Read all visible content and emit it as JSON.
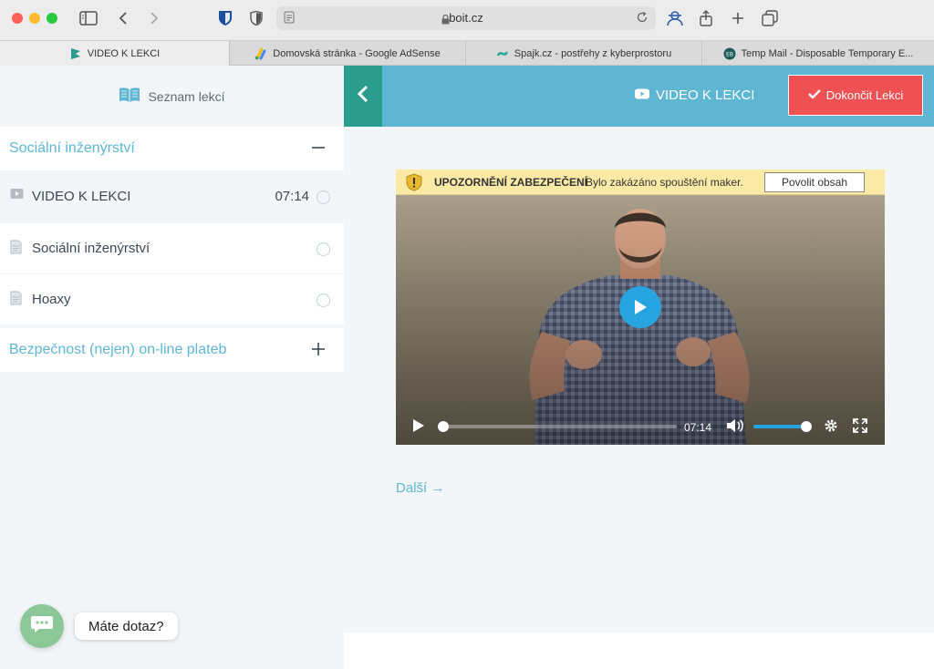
{
  "browser": {
    "url": "boit.cz",
    "tabs": [
      {
        "label": "VIDEO K LEKCI",
        "active": true
      },
      {
        "label": "Domovská stránka - Google AdSense",
        "active": false
      },
      {
        "label": "Spajk.cz - postřehy z kyberprostoru",
        "active": false
      },
      {
        "label": "Temp Mail - Disposable Temporary E...",
        "active": false
      }
    ]
  },
  "sidebar": {
    "header": "Seznam lekcí",
    "sections": [
      {
        "title": "Sociální inženýrství",
        "expanded": true,
        "lessons": [
          {
            "title": "VIDEO K LEKCI",
            "duration": "07:14",
            "type": "video",
            "current": true
          },
          {
            "title": "Sociální inženýrství",
            "duration": "",
            "type": "document",
            "current": false
          },
          {
            "title": "Hoaxy",
            "duration": "",
            "type": "document",
            "current": false
          }
        ]
      },
      {
        "title": "Bezpečnost (nejen) on-line plateb",
        "expanded": false,
        "lessons": []
      }
    ]
  },
  "topbar": {
    "title": "VIDEO K LEKCI",
    "finish_label": "Dokončit Lekci"
  },
  "video": {
    "security_title": "UPOZORNĚNÍ ZABEZPEČENÍ",
    "security_message": "Bylo zakázáno spouštění maker.",
    "allow_label": "Povolit obsah",
    "time": "07:14",
    "progress": 0.0,
    "volume": 1.0
  },
  "next_label": "Další →",
  "chat": {
    "label": "Máte dotaz?"
  },
  "colors": {
    "accent": "#5eb6d3",
    "back": "#2a9d8f",
    "finish": "#ef5054",
    "play": "#27a4e0",
    "chat": "#8cc798"
  }
}
